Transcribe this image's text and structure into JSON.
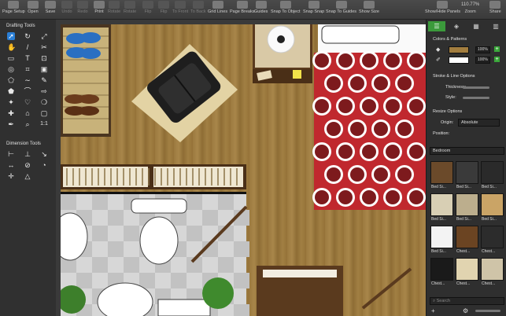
{
  "toolbar": {
    "items": [
      {
        "label": "Page Setup",
        "enabled": true
      },
      {
        "label": "Open",
        "enabled": true
      },
      {
        "label": "Save",
        "enabled": true
      },
      {
        "label": "Undo",
        "enabled": false
      },
      {
        "label": "Redo",
        "enabled": false
      },
      {
        "label": "Print",
        "enabled": true
      },
      {
        "label": "Rotate",
        "enabled": false
      },
      {
        "label": "Rotate",
        "enabled": false
      },
      {
        "label": "Flip",
        "enabled": false
      },
      {
        "label": "Flip",
        "enabled": false
      },
      {
        "label": "To Front",
        "enabled": false
      },
      {
        "label": "To Back",
        "enabled": false
      },
      {
        "label": "Grid Lines",
        "enabled": true
      },
      {
        "label": "Page Breaks",
        "enabled": true
      },
      {
        "label": "Guides",
        "enabled": true
      },
      {
        "label": "Snap To Object",
        "enabled": true
      },
      {
        "label": "Snap Snap",
        "enabled": true
      },
      {
        "label": "Snap To Guides",
        "enabled": true
      },
      {
        "label": "Show Size",
        "enabled": true
      },
      {
        "label": "Show/Hide Panels",
        "enabled": true
      },
      {
        "label": "Zoom",
        "enabled": true
      },
      {
        "label": "Share",
        "enabled": true
      }
    ],
    "zoom_value": "110.77%"
  },
  "left_panel": {
    "drafting_title": "Drafting Tools",
    "dimension_title": "Dimension Tools",
    "tool_glyph_11": "1:1"
  },
  "right_panel": {
    "colors_title": "Colors & Patterns",
    "fill_opacity": "100%",
    "line_opacity": "100%",
    "stroke_title": "Stroke & Line Options",
    "thickness_label": "Thickness:",
    "style_label": "Style:",
    "resize_title": "Resize Options",
    "origin_label": "Origin:",
    "origin_value": "Absolute",
    "position_label": "Position:",
    "library_category": "Bedroom",
    "library_items": [
      "Bed Si...",
      "Bed Si...",
      "Bed Si...",
      "Bed Si...",
      "Bed Si...",
      "Bed Si...",
      "Bed Si...",
      "Chest...",
      "Chest...",
      "Chest...",
      "Chest...",
      "Chest..."
    ],
    "search_placeholder": "Search"
  },
  "colors": {
    "accent": "#3b9a3b",
    "selection": "#2a7fd6",
    "floor_wood": "#9c7a3f",
    "bed_red": "#c0282e"
  }
}
